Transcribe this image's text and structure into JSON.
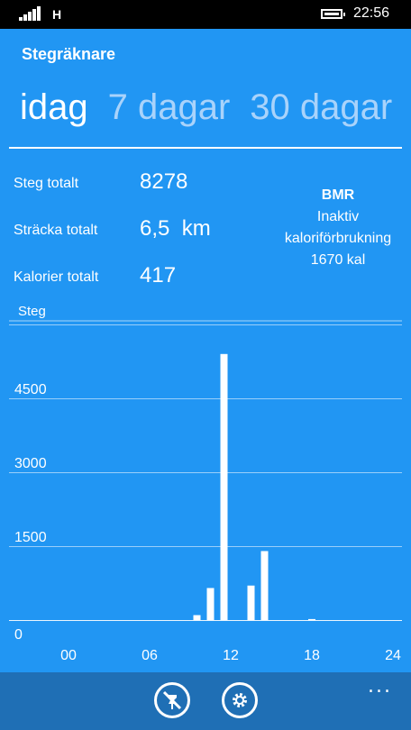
{
  "status": {
    "network": "H",
    "time": "22:56"
  },
  "app": {
    "title": "Stegräknare"
  },
  "tabs": [
    {
      "label": "idag",
      "active": true
    },
    {
      "label": "7 dagar",
      "active": false
    },
    {
      "label": "30 dagar",
      "active": false
    }
  ],
  "stats": {
    "steps_label": "Steg totalt",
    "steps_value": "8278",
    "distance_label": "Sträcka totalt",
    "distance_value": "6,5  km",
    "calories_label": "Kalorier totalt",
    "calories_value": "417"
  },
  "bmr": {
    "title": "BMR",
    "line1": "Inaktiv",
    "line2": "kaloriförbrukning",
    "line3": "1670 kal"
  },
  "appbar": {
    "icons": [
      "pin-off-icon",
      "settings-icon"
    ],
    "more": "..."
  },
  "colors": {
    "background": "#2196f3",
    "appbar": "#1f6fb5",
    "inactive_tab": "#a9d3fb"
  },
  "chart_data": {
    "type": "bar",
    "ylabel": "Steg",
    "yticks": [
      "6000",
      "4500",
      "3000",
      "1500",
      "0"
    ],
    "ytick_values": [
      6000,
      4500,
      3000,
      1500,
      0
    ],
    "xticks": [
      "00",
      "06",
      "12",
      "18",
      "24"
    ],
    "xtick_values": [
      0,
      6,
      12,
      18,
      24
    ],
    "ylim": [
      0,
      6000
    ],
    "xlim": [
      0,
      24
    ],
    "grid": true,
    "x": [
      9.5,
      10.5,
      11.5,
      13.5,
      14.5,
      18
    ],
    "values": [
      100,
      650,
      5400,
      700,
      1400,
      20
    ]
  }
}
